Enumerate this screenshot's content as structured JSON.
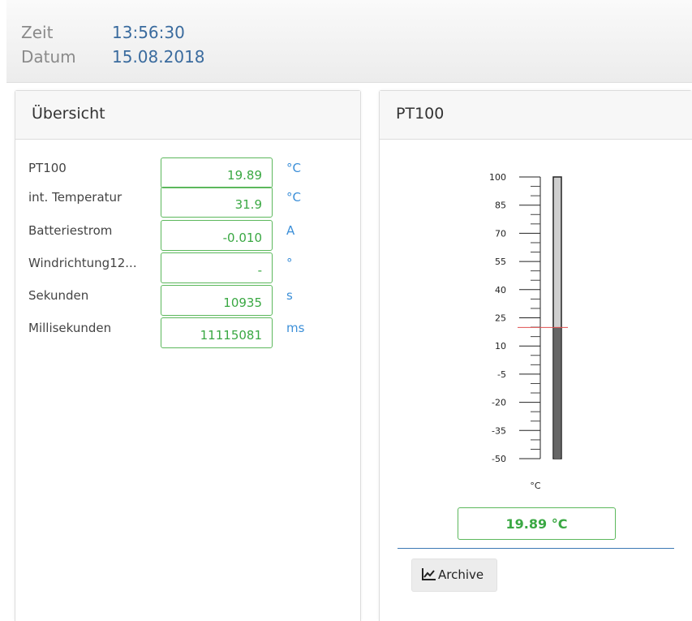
{
  "header": {
    "time_label": "Zeit",
    "time_value": "13:56:30",
    "date_label": "Datum",
    "date_value": "15.08.2018"
  },
  "overview": {
    "title": "Übersicht",
    "rows": [
      {
        "label": "PT100",
        "value": "19.89",
        "unit": "°C"
      },
      {
        "label": "int. Temperatur",
        "value": "31.9",
        "unit": "°C"
      },
      {
        "label": "Batteriestrom",
        "value": "-0.010",
        "unit": "A"
      },
      {
        "label": "Windrichtung12...",
        "value": "-",
        "unit": "°"
      },
      {
        "label": "Sekunden",
        "value": "10935",
        "unit": "s"
      },
      {
        "label": "Millisekunden",
        "value": "11115081",
        "unit": "ms"
      }
    ]
  },
  "pt100": {
    "title": "PT100",
    "gauge": {
      "min": -50,
      "max": 100,
      "ticks": [
        "100",
        "85",
        "70",
        "55",
        "40",
        "25",
        "10",
        "-5",
        "-20",
        "-35",
        "-50"
      ],
      "value": 19.89,
      "unit": "°C",
      "marker_color": "#e05050",
      "fill_color": "#666666",
      "track_color": "#cfcfcf"
    },
    "value_display": "19.89 °C",
    "archive_label": "Archive",
    "archive_icon": "line-chart-icon"
  },
  "colors": {
    "accent_green": "#3aa843",
    "unit_blue": "#3c8fd8",
    "header_value": "#3a6b9e"
  }
}
